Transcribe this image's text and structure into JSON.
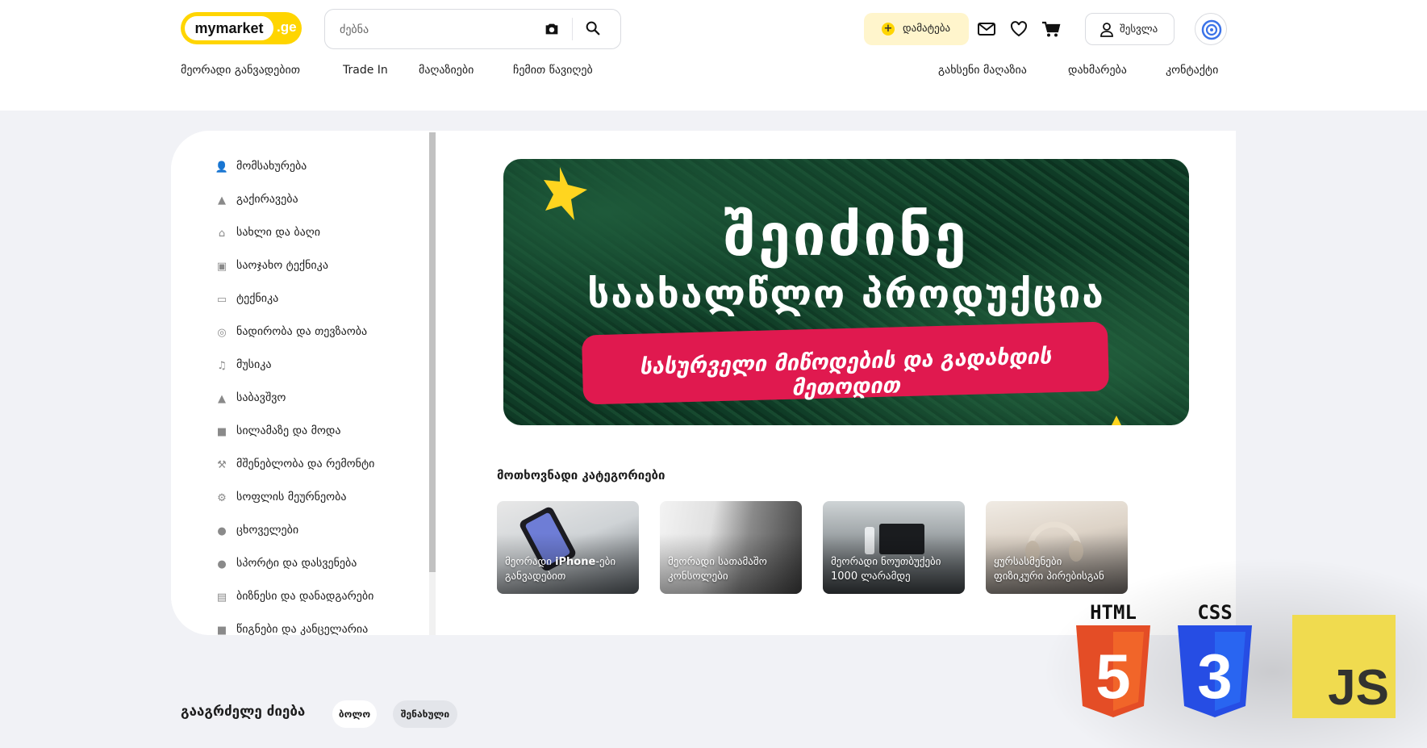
{
  "header": {
    "logo_text": "mymarket",
    "logo_suffix": ".ge",
    "search_placeholder": "ძებნა",
    "add_label": "დამატება",
    "login_label": "შესვლა"
  },
  "nav_left": [
    "მეორადი განვადებით",
    "Trade In",
    "მაღაზიები",
    "ჩემით წავიღებ"
  ],
  "nav_right": [
    "გახსენი მაღაზია",
    "დახმარება",
    "კონტაქტი"
  ],
  "categories": [
    {
      "label": "მომსახურება",
      "icon": "person-icon"
    },
    {
      "label": "გაქირავება",
      "icon": "shapes-icon"
    },
    {
      "label": "სახლი და ბაღი",
      "icon": "home-icon"
    },
    {
      "label": "საოჯახო ტექნიკა",
      "icon": "camera-icon"
    },
    {
      "label": "ტექნიკა",
      "icon": "battery-icon"
    },
    {
      "label": "ნადირობა და თევზაობა",
      "icon": "target-icon"
    },
    {
      "label": "მუსიკა",
      "icon": "music-icon"
    },
    {
      "label": "საბავშვო",
      "icon": "stroller-icon"
    },
    {
      "label": "სილამაზე და მოდა",
      "icon": "tshirt-icon"
    },
    {
      "label": "მშენებლობა და რემონტი",
      "icon": "hammer-icon"
    },
    {
      "label": "სოფლის მეურნეობა",
      "icon": "tractor-icon"
    },
    {
      "label": "ცხოველები",
      "icon": "paw-icon"
    },
    {
      "label": "სპორტი და დასვენება",
      "icon": "ball-icon"
    },
    {
      "label": "ბიზნესი და დანადგარები",
      "icon": "archive-icon"
    },
    {
      "label": "წიგნები და კანცელარია",
      "icon": "book-icon"
    }
  ],
  "banner": {
    "title": "შეიძინე",
    "subtitle": "საახალწლო პროდუქცია",
    "pill": "სასურველი მიწოდების და გადახდის მეთოდით"
  },
  "popular": {
    "title": "მოთხოვნადი კატეგორიები",
    "cards": [
      {
        "line1_a": "მეორადი ",
        "line1_b": "iPhone",
        "line1_c": "-ები",
        "line2": "განვადებით"
      },
      {
        "line1_a": "მეორადი სათამაშო",
        "line1_b": "",
        "line1_c": "",
        "line2": "კონსოლები"
      },
      {
        "line1_a": "მეორადი ნოუთბუქები",
        "line1_b": "",
        "line1_c": "",
        "line2": "1000 ლარამდე"
      },
      {
        "line1_a": "ყურსასმენები",
        "line1_b": "",
        "line1_c": "",
        "line2": "ფიზიკური პირებისგან"
      }
    ]
  },
  "continue": {
    "title": "გააგრძელე ძიება",
    "chips": [
      "ბოლო",
      "შენახული"
    ]
  },
  "tech_badges": {
    "html": "HTML",
    "css": "CSS",
    "js": "JS",
    "html_number": "5",
    "css_number": "3"
  },
  "colors": {
    "brand_yellow": "#ffd500",
    "banner_pill": "#e0194f",
    "background": "#f1f2f6"
  }
}
